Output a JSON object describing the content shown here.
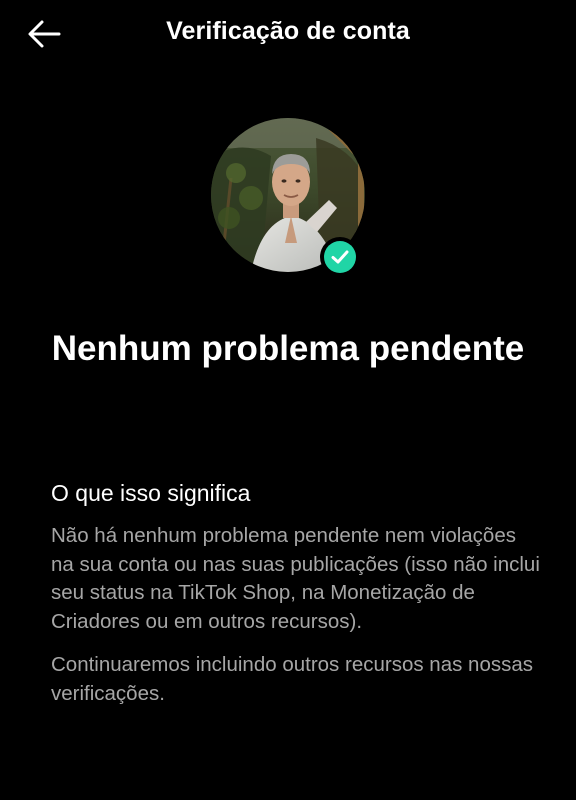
{
  "header": {
    "title": "Verificação de conta",
    "back_icon": "arrow-left-icon"
  },
  "profile": {
    "badge_icon": "check-icon",
    "badge_color": "#20D5A6"
  },
  "status": {
    "title": "Nenhum problema pendente"
  },
  "info": {
    "heading": "O que isso significa",
    "paragraph1": "Não há nenhum problema pendente nem violações na sua conta ou nas suas publicações (isso não inclui seu status na TikTok Shop, na Monetização de Criadores ou em outros recursos).",
    "paragraph2": "Continuaremos incluindo outros recursos nas nossas verificações."
  },
  "colors": {
    "background": "#000000",
    "text_primary": "#FFFFFF",
    "text_secondary": "#A6A6A6",
    "accent": "#20D5A6"
  }
}
